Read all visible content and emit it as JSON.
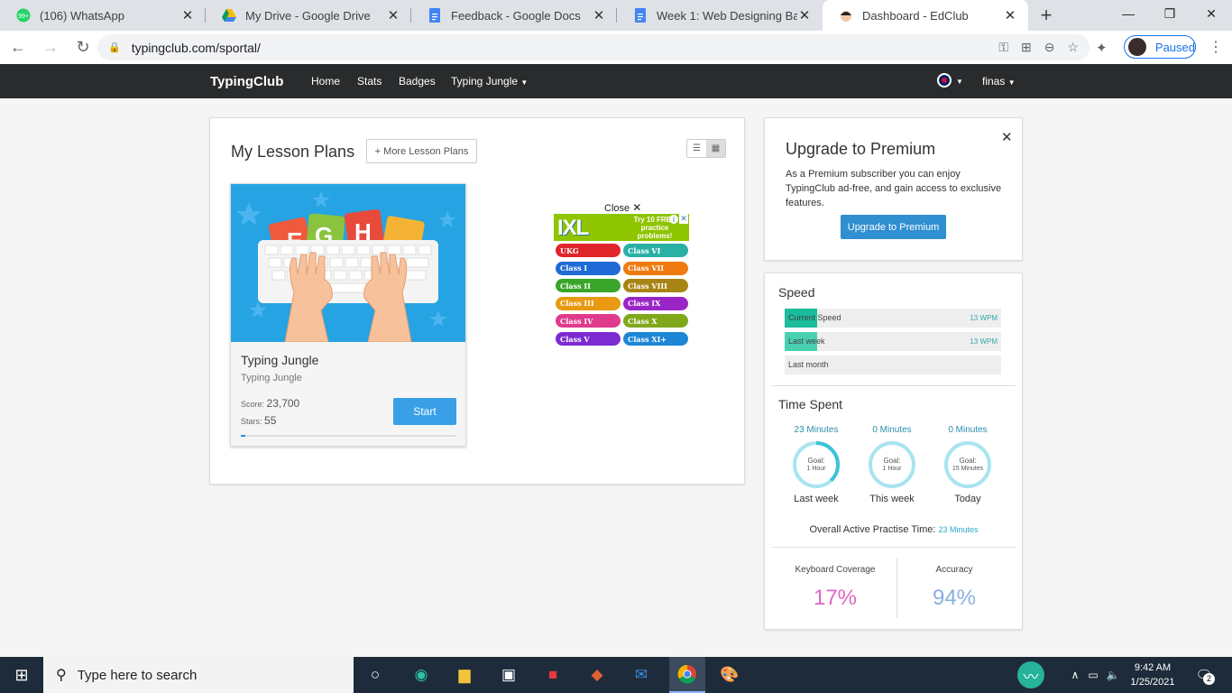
{
  "browser": {
    "tabs": [
      {
        "title": "(106) WhatsApp",
        "badge": "99+"
      },
      {
        "title": "My Drive - Google Drive"
      },
      {
        "title": "Feedback - Google Docs"
      },
      {
        "title": "Week 1: Web Designing Basics"
      },
      {
        "title": "Dashboard - EdClub"
      }
    ],
    "url": "typingclub.com/sportal/",
    "profile_status": "Paused"
  },
  "nav": {
    "brand": "TypingClub",
    "links": [
      "Home",
      "Stats",
      "Badges",
      "Typing Jungle"
    ],
    "user": "finas"
  },
  "lesson_plans": {
    "title": "My Lesson Plans",
    "more_button": "+ More Lesson Plans",
    "card": {
      "name": "Typing Jungle",
      "subtitle": "Typing Jungle",
      "score_label": "Score:",
      "score": "23,700",
      "stars_label": "Stars:",
      "stars": "55",
      "start_label": "Start",
      "progress": 0.02
    }
  },
  "ad": {
    "close_label": "Close",
    "logo": "IXL",
    "headline": "Try 10 FREE practice problems!",
    "left_pills": [
      {
        "label": "UKG",
        "color": "#e0262a"
      },
      {
        "label": "Class I",
        "color": "#1f6ad6"
      },
      {
        "label": "Class II",
        "color": "#3aa52a"
      },
      {
        "label": "Class III",
        "color": "#e89a12"
      },
      {
        "label": "Class IV",
        "color": "#e03a8c"
      },
      {
        "label": "Class V",
        "color": "#7b2bd1"
      }
    ],
    "right_pills": [
      {
        "label": "Class VI",
        "color": "#2ab1a6"
      },
      {
        "label": "Class VII",
        "color": "#ef7b10"
      },
      {
        "label": "Class VIII",
        "color": "#a88414"
      },
      {
        "label": "Class IX",
        "color": "#9a25c6"
      },
      {
        "label": "Class X",
        "color": "#7fa81a"
      },
      {
        "label": "Class XI+",
        "color": "#1d86d6"
      }
    ]
  },
  "premium": {
    "title": "Upgrade to Premium",
    "description": "As a Premium subscriber you can enjoy TypingClub ad-free, and gain access to exclusive features.",
    "button": "Upgrade to Premium"
  },
  "speed": {
    "title": "Speed",
    "rows": [
      {
        "label": "Current Speed",
        "value": "13 WPM",
        "fill": 0.15,
        "color": "#1abc9c"
      },
      {
        "label": "Last week",
        "value": "13 WPM",
        "fill": 0.15,
        "color": "#48d1b0"
      },
      {
        "label": "Last month",
        "value": "",
        "fill": 0,
        "color": "#1abc9c"
      }
    ]
  },
  "time_spent": {
    "title": "Time Spent",
    "columns": [
      {
        "minutes": "23 Minutes",
        "goal_label": "Goal:",
        "goal": "1 Hour",
        "period": "Last week",
        "progress": 0.38
      },
      {
        "minutes": "0 Minutes",
        "goal_label": "Goal:",
        "goal": "1 Hour",
        "period": "This week",
        "progress": 0
      },
      {
        "minutes": "0 Minutes",
        "goal_label": "Goal:",
        "goal": "15 Minutes",
        "period": "Today",
        "progress": 0
      }
    ],
    "overall_label": "Overall Active Practise Time:",
    "overall_value": "23 Minutes"
  },
  "stats": {
    "coverage_label": "Keyboard Coverage",
    "coverage_value": "17%",
    "coverage_color": "#e066c0",
    "accuracy_label": "Accuracy",
    "accuracy_value": "94%",
    "accuracy_color": "#8aaee0"
  },
  "taskbar": {
    "search_placeholder": "Type here to search",
    "time": "9:42 AM",
    "date": "1/25/2021",
    "notifications": "2"
  }
}
